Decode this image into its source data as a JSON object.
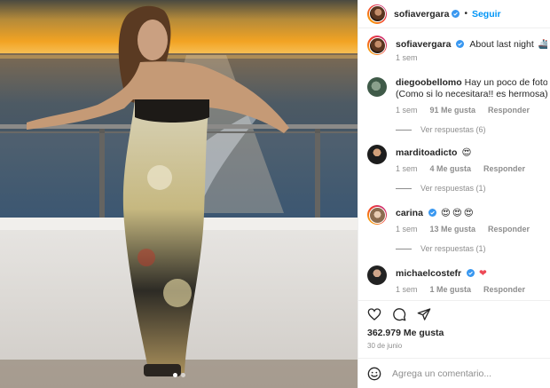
{
  "post": {
    "author": "sofiavergara",
    "follow_label": "Seguir",
    "separator": "•",
    "caption": "About last night",
    "caption_time": "1 sem",
    "likes": "362.979 Me gusta",
    "date": "30 de junio",
    "add_comment_placeholder": "Agrega un comentario..."
  },
  "comments": [
    {
      "user": "diegoobellomo",
      "text": "Hay un poco de foto en t",
      "text2": "(Como si lo necesitara!! es hermosa)",
      "time": "1 sem",
      "likes": "91 Me gusta",
      "reply": "Responder",
      "view_replies": "Ver respuestas (6)"
    },
    {
      "user": "marditoadicto",
      "text": "",
      "time": "1 sem",
      "likes": "4 Me gusta",
      "reply": "Responder",
      "view_replies": "Ver respuestas (1)"
    },
    {
      "user": "carina",
      "text": "",
      "time": "1 sem",
      "likes": "13 Me gusta",
      "reply": "Responder",
      "view_replies": "Ver respuestas (1)"
    },
    {
      "user": "michaelcostefr",
      "text": "",
      "time": "1 sem",
      "likes": "1 Me gusta",
      "reply": "Responder"
    }
  ],
  "colors": {
    "accent": "#0095f6",
    "verified": "#3897f0",
    "heart": "#ed4956",
    "muted": "#8e8e8e"
  },
  "icons": {
    "like": "heart-outline-icon",
    "comment": "comment-bubble-icon",
    "share": "paper-plane-icon",
    "emoji": "smiley-icon"
  }
}
